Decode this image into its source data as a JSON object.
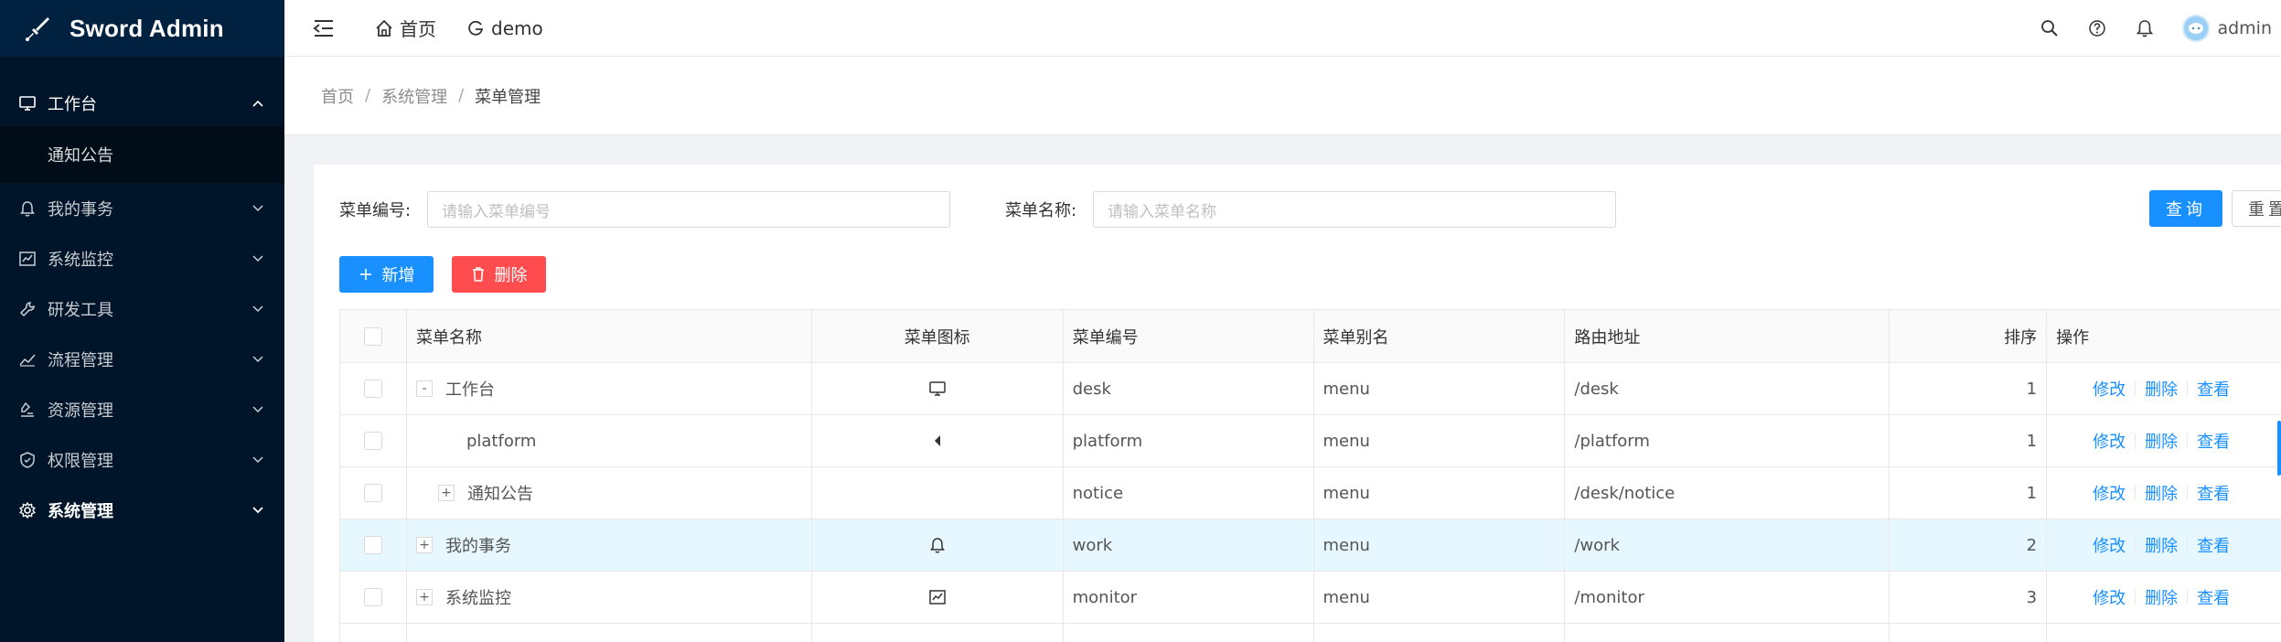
{
  "app": {
    "title": "Sword Admin"
  },
  "sidebar": {
    "items": [
      {
        "label": "工作台",
        "icon": "monitor-icon",
        "expanded": true
      },
      {
        "label": "我的事务",
        "icon": "bell-icon"
      },
      {
        "label": "系统监控",
        "icon": "chart-icon"
      },
      {
        "label": "研发工具",
        "icon": "tool-icon"
      },
      {
        "label": "流程管理",
        "icon": "line-chart-icon"
      },
      {
        "label": "资源管理",
        "icon": "stamp-icon"
      },
      {
        "label": "权限管理",
        "icon": "shield-icon"
      },
      {
        "label": "系统管理",
        "icon": "gear-icon",
        "active": true
      }
    ],
    "submenu": {
      "label": "通知公告"
    }
  },
  "header": {
    "tabs": [
      {
        "label": "首页",
        "icon": "home-icon"
      },
      {
        "label": "demo",
        "icon": "google-icon"
      }
    ],
    "user": {
      "name": "admin"
    }
  },
  "breadcrumb": [
    "首页",
    "系统管理",
    "菜单管理"
  ],
  "search": {
    "code_label": "菜单编号:",
    "code_placeholder": "请输入菜单编号",
    "name_label": "菜单名称:",
    "name_placeholder": "请输入菜单名称",
    "query_label": "查询",
    "reset_label": "重置"
  },
  "actions": {
    "add_label": "新增",
    "delete_label": "删除"
  },
  "table": {
    "columns": [
      "菜单名称",
      "菜单图标",
      "菜单编号",
      "菜单别名",
      "路由地址",
      "排序",
      "操作"
    ],
    "rows": [
      {
        "expander": "-",
        "name": "工作台",
        "icon": "monitor-icon",
        "code": "desk",
        "alias": "menu",
        "route": "/desk",
        "sort": "1"
      },
      {
        "expander": "",
        "name": "platform",
        "icon": "caret-left-icon",
        "code": "platform",
        "alias": "menu",
        "route": "/platform",
        "sort": "1"
      },
      {
        "expander": "+",
        "name": "通知公告",
        "icon": "",
        "code": "notice",
        "alias": "menu",
        "route": "/desk/notice",
        "sort": "1"
      },
      {
        "expander": "+",
        "name": "我的事务",
        "icon": "bell-icon",
        "code": "work",
        "alias": "menu",
        "route": "/work",
        "sort": "2"
      },
      {
        "expander": "+",
        "name": "系统监控",
        "icon": "chart-icon",
        "code": "monitor",
        "alias": "menu",
        "route": "/monitor",
        "sort": "3"
      }
    ],
    "ops": {
      "edit": "修改",
      "delete": "删除",
      "view": "查看"
    }
  },
  "colors": {
    "sidebar_bg": "#001529",
    "primary": "#1890ff",
    "danger": "#ff4d4f",
    "row_hover": "#e6f7ff"
  }
}
